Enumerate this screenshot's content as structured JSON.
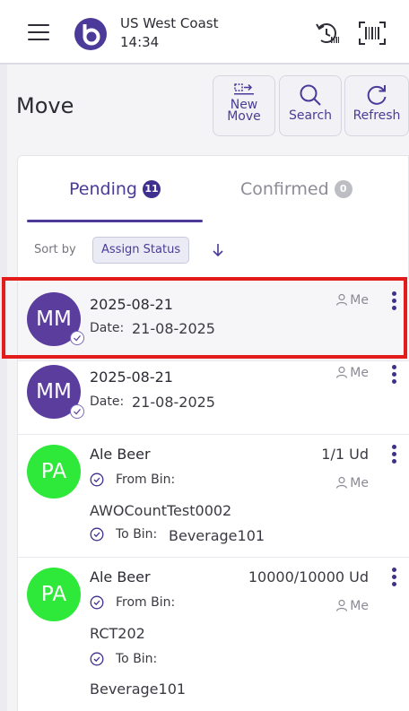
{
  "header": {
    "location": "US West Coast",
    "time": "14:34",
    "icons": [
      "menu-icon",
      "logo-icon",
      "history-icon",
      "barcode-icon"
    ]
  },
  "page": {
    "title": "Move",
    "actions": {
      "new_move": [
        "New",
        "Move"
      ],
      "search": "Search",
      "refresh": "Refresh"
    }
  },
  "tabs": {
    "pending": {
      "label": "Pending",
      "count": "11"
    },
    "confirmed": {
      "label": "Confirmed",
      "count": "0"
    }
  },
  "sort": {
    "label": "Sort by",
    "value": "Assign Status",
    "direction": "descending"
  },
  "rows": [
    {
      "initials": "MM",
      "title": "2025-08-21",
      "date_label": "Date:",
      "date_value": "21-08-2025",
      "assignee": "Me"
    },
    {
      "initials": "MM",
      "title": "2025-08-21",
      "date_label": "Date:",
      "date_value": "21-08-2025",
      "assignee": "Me"
    },
    {
      "initials": "PA",
      "title": "Ale Beer",
      "qty": "1/1 Ud",
      "from_label": "From Bin:",
      "from_value": "AWOCountTest0002",
      "to_label": "To Bin:",
      "to_value": "Beverage101",
      "assignee": "Me"
    },
    {
      "initials": "PA",
      "title": "Ale Beer",
      "qty": "10000/10000 Ud",
      "from_label": "From Bin:",
      "from_value": "RCT202",
      "to_label": "To Bin:",
      "to_value": "Beverage101",
      "assignee": "Me"
    }
  ],
  "colors": {
    "accent": "#4b3a99",
    "avatar_purple": "#5b3d9e",
    "avatar_green": "#2ee83a",
    "highlight": "#e31b1b"
  }
}
